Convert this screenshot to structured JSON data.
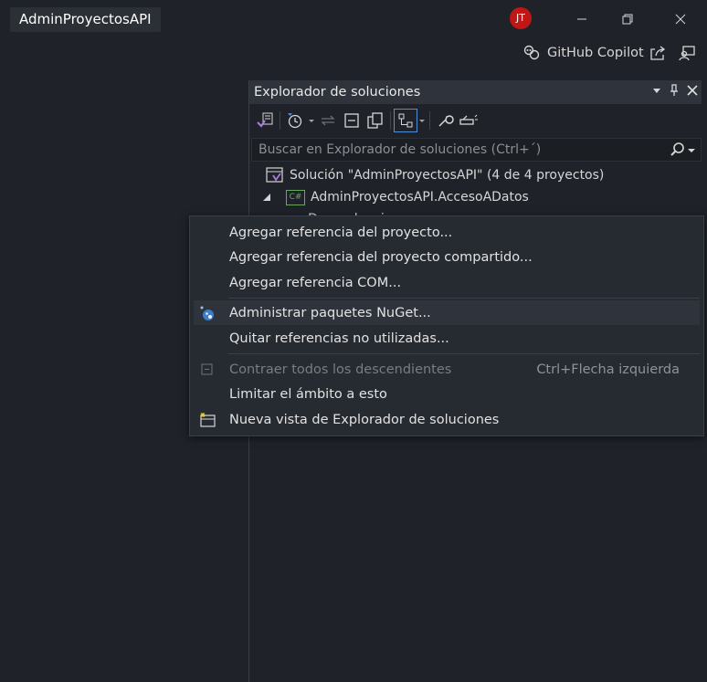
{
  "window": {
    "title": "AdminProyectosAPI",
    "avatar_initials": "JT",
    "copilot_label": "GitHub Copilot"
  },
  "solution_explorer": {
    "title": "Explorador de soluciones",
    "search_placeholder": "Buscar en Explorador de soluciones (Ctrl+´)",
    "tree": [
      {
        "label": "Solución \"AdminProyectosAPI\"  (4 de 4 proyectos)"
      },
      {
        "label": "AdminProyectosAPI.AccesoADatos",
        "badge": "C#"
      },
      {
        "label": "Dependencias"
      }
    ]
  },
  "context_menu": {
    "items": [
      {
        "label": "Agregar referencia del proyecto..."
      },
      {
        "label": "Agregar referencia del proyecto compartido..."
      },
      {
        "label": "Agregar referencia COM..."
      },
      {
        "label": "Administrar paquetes NuGet...",
        "icon": "nuget-icon"
      },
      {
        "label": "Quitar referencias no utilizadas..."
      },
      {
        "label": "Contraer todos los descendientes",
        "shortcut": "Ctrl+Flecha izquierda",
        "icon": "collapse-icon",
        "disabled": true
      },
      {
        "label": "Limitar el ámbito a esto"
      },
      {
        "label": "Nueva vista de Explorador de soluciones",
        "icon": "new-view-icon"
      }
    ]
  },
  "colors": {
    "background": "#1f2329",
    "menu_background": "#262a31",
    "accent_blue": "#4f8fd6",
    "avatar": "#c01616",
    "csharp_badge": "#68a85a"
  }
}
